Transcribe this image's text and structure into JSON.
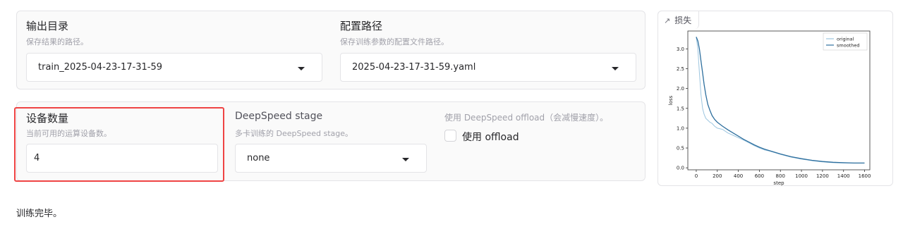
{
  "top_panel": {
    "output_dir": {
      "label": "输出目录",
      "description": "保存结果的路径。",
      "value": "train_2025-04-23-17-31-59"
    },
    "config_path": {
      "label": "配置路径",
      "description": "保存训练参数的配置文件路径。",
      "value": "2025-04-23-17-31-59.yaml"
    }
  },
  "mid_panel": {
    "device_count": {
      "label": "设备数量",
      "description": "当前可用的运算设备数。",
      "value": "4"
    },
    "ds_stage": {
      "label": "DeepSpeed stage",
      "description": "多卡训练的 DeepSpeed stage。",
      "value": "none"
    },
    "ds_offload": {
      "label": "使用 DeepSpeed offload（会减慢速度）。",
      "checkbox_label": "使用 offload",
      "checked": false
    }
  },
  "plot": {
    "tab_label": "损失",
    "tab_icon": "chart-icon"
  },
  "status": "训练完毕。",
  "colors": {
    "highlight": "#ef4444",
    "original_line": "#9cc5df",
    "smoothed_line": "#2e6f9e"
  },
  "chart_data": {
    "type": "line",
    "xlabel": "step",
    "ylabel": "loss",
    "xlim": [
      -80,
      1650
    ],
    "ylim": [
      -0.05,
      3.45
    ],
    "xticks": [
      0,
      200,
      400,
      600,
      800,
      1000,
      1200,
      1400,
      1600
    ],
    "yticks": [
      0.0,
      0.5,
      1.0,
      1.5,
      2.0,
      2.5,
      3.0
    ],
    "legend": "top-right",
    "grid": false,
    "series": [
      {
        "name": "original",
        "x": [
          0,
          15,
          30,
          45,
          60,
          75,
          90,
          110,
          130,
          150,
          175,
          200,
          250,
          300,
          350,
          400,
          450,
          500,
          550,
          600,
          650,
          700,
          800,
          900,
          1000,
          1100,
          1200,
          1300,
          1400,
          1500,
          1600
        ],
        "y": [
          3.3,
          3.0,
          2.4,
          1.85,
          1.5,
          1.35,
          1.25,
          1.2,
          1.15,
          1.12,
          1.05,
          1.0,
          0.97,
          0.88,
          0.82,
          0.76,
          0.7,
          0.63,
          0.56,
          0.5,
          0.45,
          0.42,
          0.34,
          0.27,
          0.22,
          0.18,
          0.15,
          0.13,
          0.12,
          0.12,
          0.12
        ]
      },
      {
        "name": "smoothed",
        "x": [
          0,
          15,
          30,
          45,
          60,
          75,
          90,
          110,
          130,
          150,
          175,
          200,
          250,
          300,
          350,
          400,
          450,
          500,
          550,
          600,
          650,
          700,
          800,
          900,
          1000,
          1100,
          1200,
          1300,
          1400,
          1500,
          1600
        ],
        "y": [
          3.3,
          3.2,
          3.0,
          2.7,
          2.4,
          2.1,
          1.85,
          1.6,
          1.45,
          1.32,
          1.22,
          1.15,
          1.05,
          0.96,
          0.88,
          0.8,
          0.72,
          0.65,
          0.58,
          0.52,
          0.47,
          0.43,
          0.35,
          0.28,
          0.23,
          0.19,
          0.16,
          0.14,
          0.13,
          0.12,
          0.12
        ]
      }
    ]
  }
}
